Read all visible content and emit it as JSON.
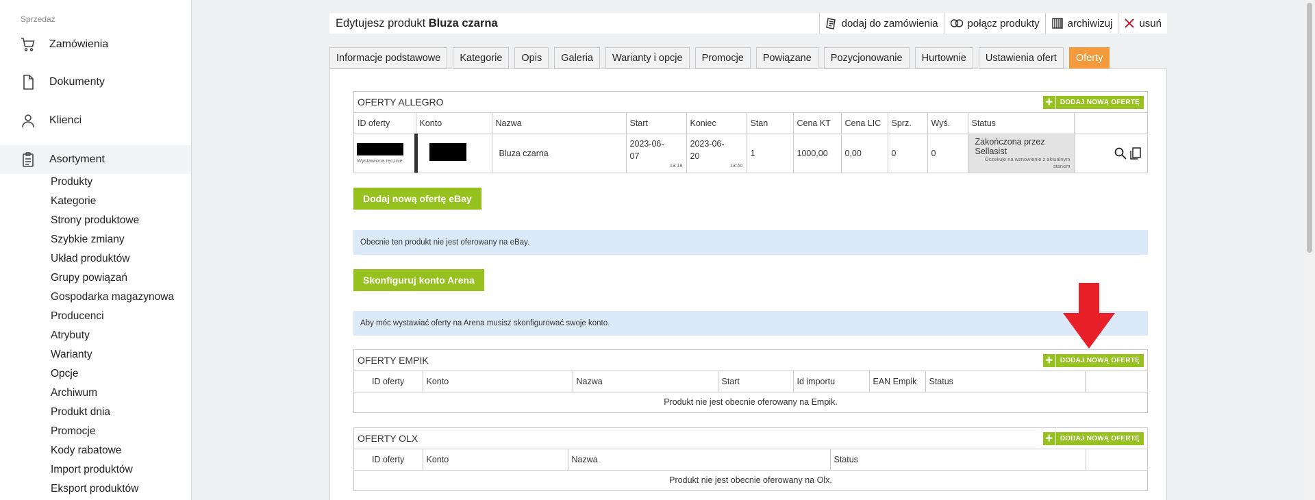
{
  "sidebar": {
    "section_label": "Sprzedaż",
    "nav": [
      {
        "label": "Zamówienia",
        "icon": "cart-icon"
      },
      {
        "label": "Dokumenty",
        "icon": "document-icon"
      },
      {
        "label": "Klienci",
        "icon": "user-icon"
      },
      {
        "label": "Asortyment",
        "icon": "clipboard-icon"
      }
    ],
    "sub_items": [
      "Produkty",
      "Kategorie",
      "Strony produktowe",
      "Szybkie zmiany",
      "Układ produktów",
      "Grupy powiązań",
      "Gospodarka magazynowa",
      "Producenci",
      "Atrybuty",
      "Warianty",
      "Opcje",
      "Archiwum",
      "Produkt dnia",
      "Promocje",
      "Kody rabatowe",
      "Import produktów",
      "Eksport produktów"
    ]
  },
  "header": {
    "title_prefix": "Edytujesz produkt",
    "product_name": "Bluza czarna",
    "actions": [
      "dodaj do zamówienia",
      "połącz produkty",
      "archiwizuj",
      "usuń"
    ]
  },
  "tabs": [
    "Informacje podstawowe",
    "Kategorie",
    "Opis",
    "Galeria",
    "Warianty i opcje",
    "Promocje",
    "Powiązane",
    "Pozycjonowanie",
    "Hurtownie",
    "Ustawienia ofert",
    "Oferty"
  ],
  "allegro": {
    "title": "OFERTY ALLEGRO",
    "add_label": "DODAJ NOWĄ OFERTĘ",
    "columns": [
      "ID oferty",
      "Konto",
      "Nazwa",
      "Start",
      "Koniec",
      "Stan",
      "Cena KT",
      "Cena LIC",
      "Sprz.",
      "Wyś.",
      "Status",
      ""
    ],
    "row": {
      "id_note": "Wystawiona ręcznie",
      "name": "Bluza czarna",
      "start_date": "2023-06-07",
      "start_time": "13:18",
      "end_date": "2023-06-20",
      "end_time": "13:40",
      "stock": "1",
      "price_kt": "1000,00",
      "price_lic": "0,00",
      "sold": "0",
      "shipped": "0",
      "status": "Zakończona przez Sellasist",
      "status_note": "Oczekuje na wznowienie z aktualnym stanem"
    }
  },
  "ebay": {
    "button": "Dodaj nową ofertę eBay",
    "info": "Obecnie ten produkt nie jest oferowany na eBay."
  },
  "arena": {
    "button": "Skonfiguruj konto Arena",
    "info": "Aby móc wystawiać oferty na Arena musisz skonfigurować swoje konto."
  },
  "empik": {
    "title": "OFERTY EMPIK",
    "add_label": "DODAJ NOWĄ OFERTĘ",
    "columns": [
      "ID oferty",
      "Konto",
      "Nazwa",
      "Start",
      "Id importu",
      "EAN Empik",
      "Status",
      ""
    ],
    "empty": "Produkt nie jest obecnie oferowany na Empik."
  },
  "olx": {
    "title": "OFERTY OLX",
    "add_label": "DODAJ NOWĄ OFERTĘ",
    "columns": [
      "ID oferty",
      "Konto",
      "Nazwa",
      "Status",
      ""
    ],
    "empty": "Produkt nie jest obecnie oferowany na Olx."
  },
  "colors": {
    "accent_green": "#97c11f",
    "active_tab": "#f39b3c",
    "info_bg": "#dbe9f8",
    "arrow_red": "#e8202a"
  }
}
